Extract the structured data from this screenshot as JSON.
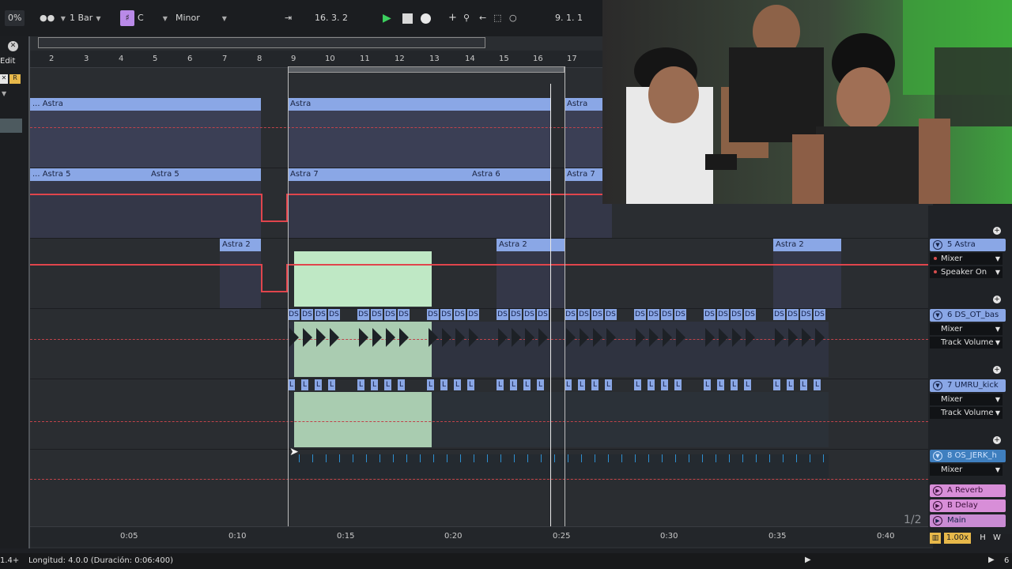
{
  "toolbar": {
    "percent": "0%",
    "follow": "1 Bar",
    "key_glyph": "♯",
    "key": "C",
    "scale": "Minor",
    "position": "16.  3.  2",
    "loop_start": "9.  1.  1"
  },
  "left": {
    "edit_label": "Edit"
  },
  "ruler": {
    "bars": [
      "2",
      "3",
      "4",
      "5",
      "6",
      "7",
      "8",
      "9",
      "10",
      "11",
      "12",
      "13",
      "14",
      "15",
      "16",
      "17"
    ]
  },
  "time_ruler": {
    "labels": [
      "0:05",
      "0:10",
      "0:15",
      "0:20",
      "0:25",
      "0:30",
      "0:35",
      "0:40"
    ]
  },
  "clips": {
    "t1": [
      "... Astra",
      "Astra",
      "Astra"
    ],
    "t2": [
      "... Astra 5",
      "Astra 5",
      "Astra 7",
      "Astra 6",
      "Astra 7"
    ],
    "t3": [
      "Astra 2",
      "Astra 2",
      "Astra 2"
    ],
    "ds": "DS",
    "kick": "L"
  },
  "mixer": {
    "tracks": [
      {
        "name": "5 Astra",
        "dd1": "Mixer",
        "dd2": "Speaker On"
      },
      {
        "name": "6 DS_OT_bas",
        "dd1": "Mixer",
        "dd2": "Track Volume"
      },
      {
        "name": "7 UMRU_kick",
        "dd1": "Mixer",
        "dd2": "Track Volume"
      },
      {
        "name": "8 OS_JERK_h",
        "dd1": "Mixer",
        "dd2": ""
      }
    ],
    "returns": [
      {
        "letter": "A",
        "name": "Reverb"
      },
      {
        "letter": "B",
        "name": "Delay"
      }
    ],
    "master": {
      "name": "Main"
    },
    "zoom": "1.00x",
    "h": "H",
    "w": "W"
  },
  "overlay": {
    "page": "1/2"
  },
  "status": {
    "left": "1.4+",
    "length": "Longitud: 4.0.0  (Duración: 0:06:400)",
    "right": "6"
  },
  "colors": {
    "clip": "#8aa7e6",
    "automation": "#e0454c",
    "selection": "#bfe8c5",
    "return": "#d88ed8"
  }
}
